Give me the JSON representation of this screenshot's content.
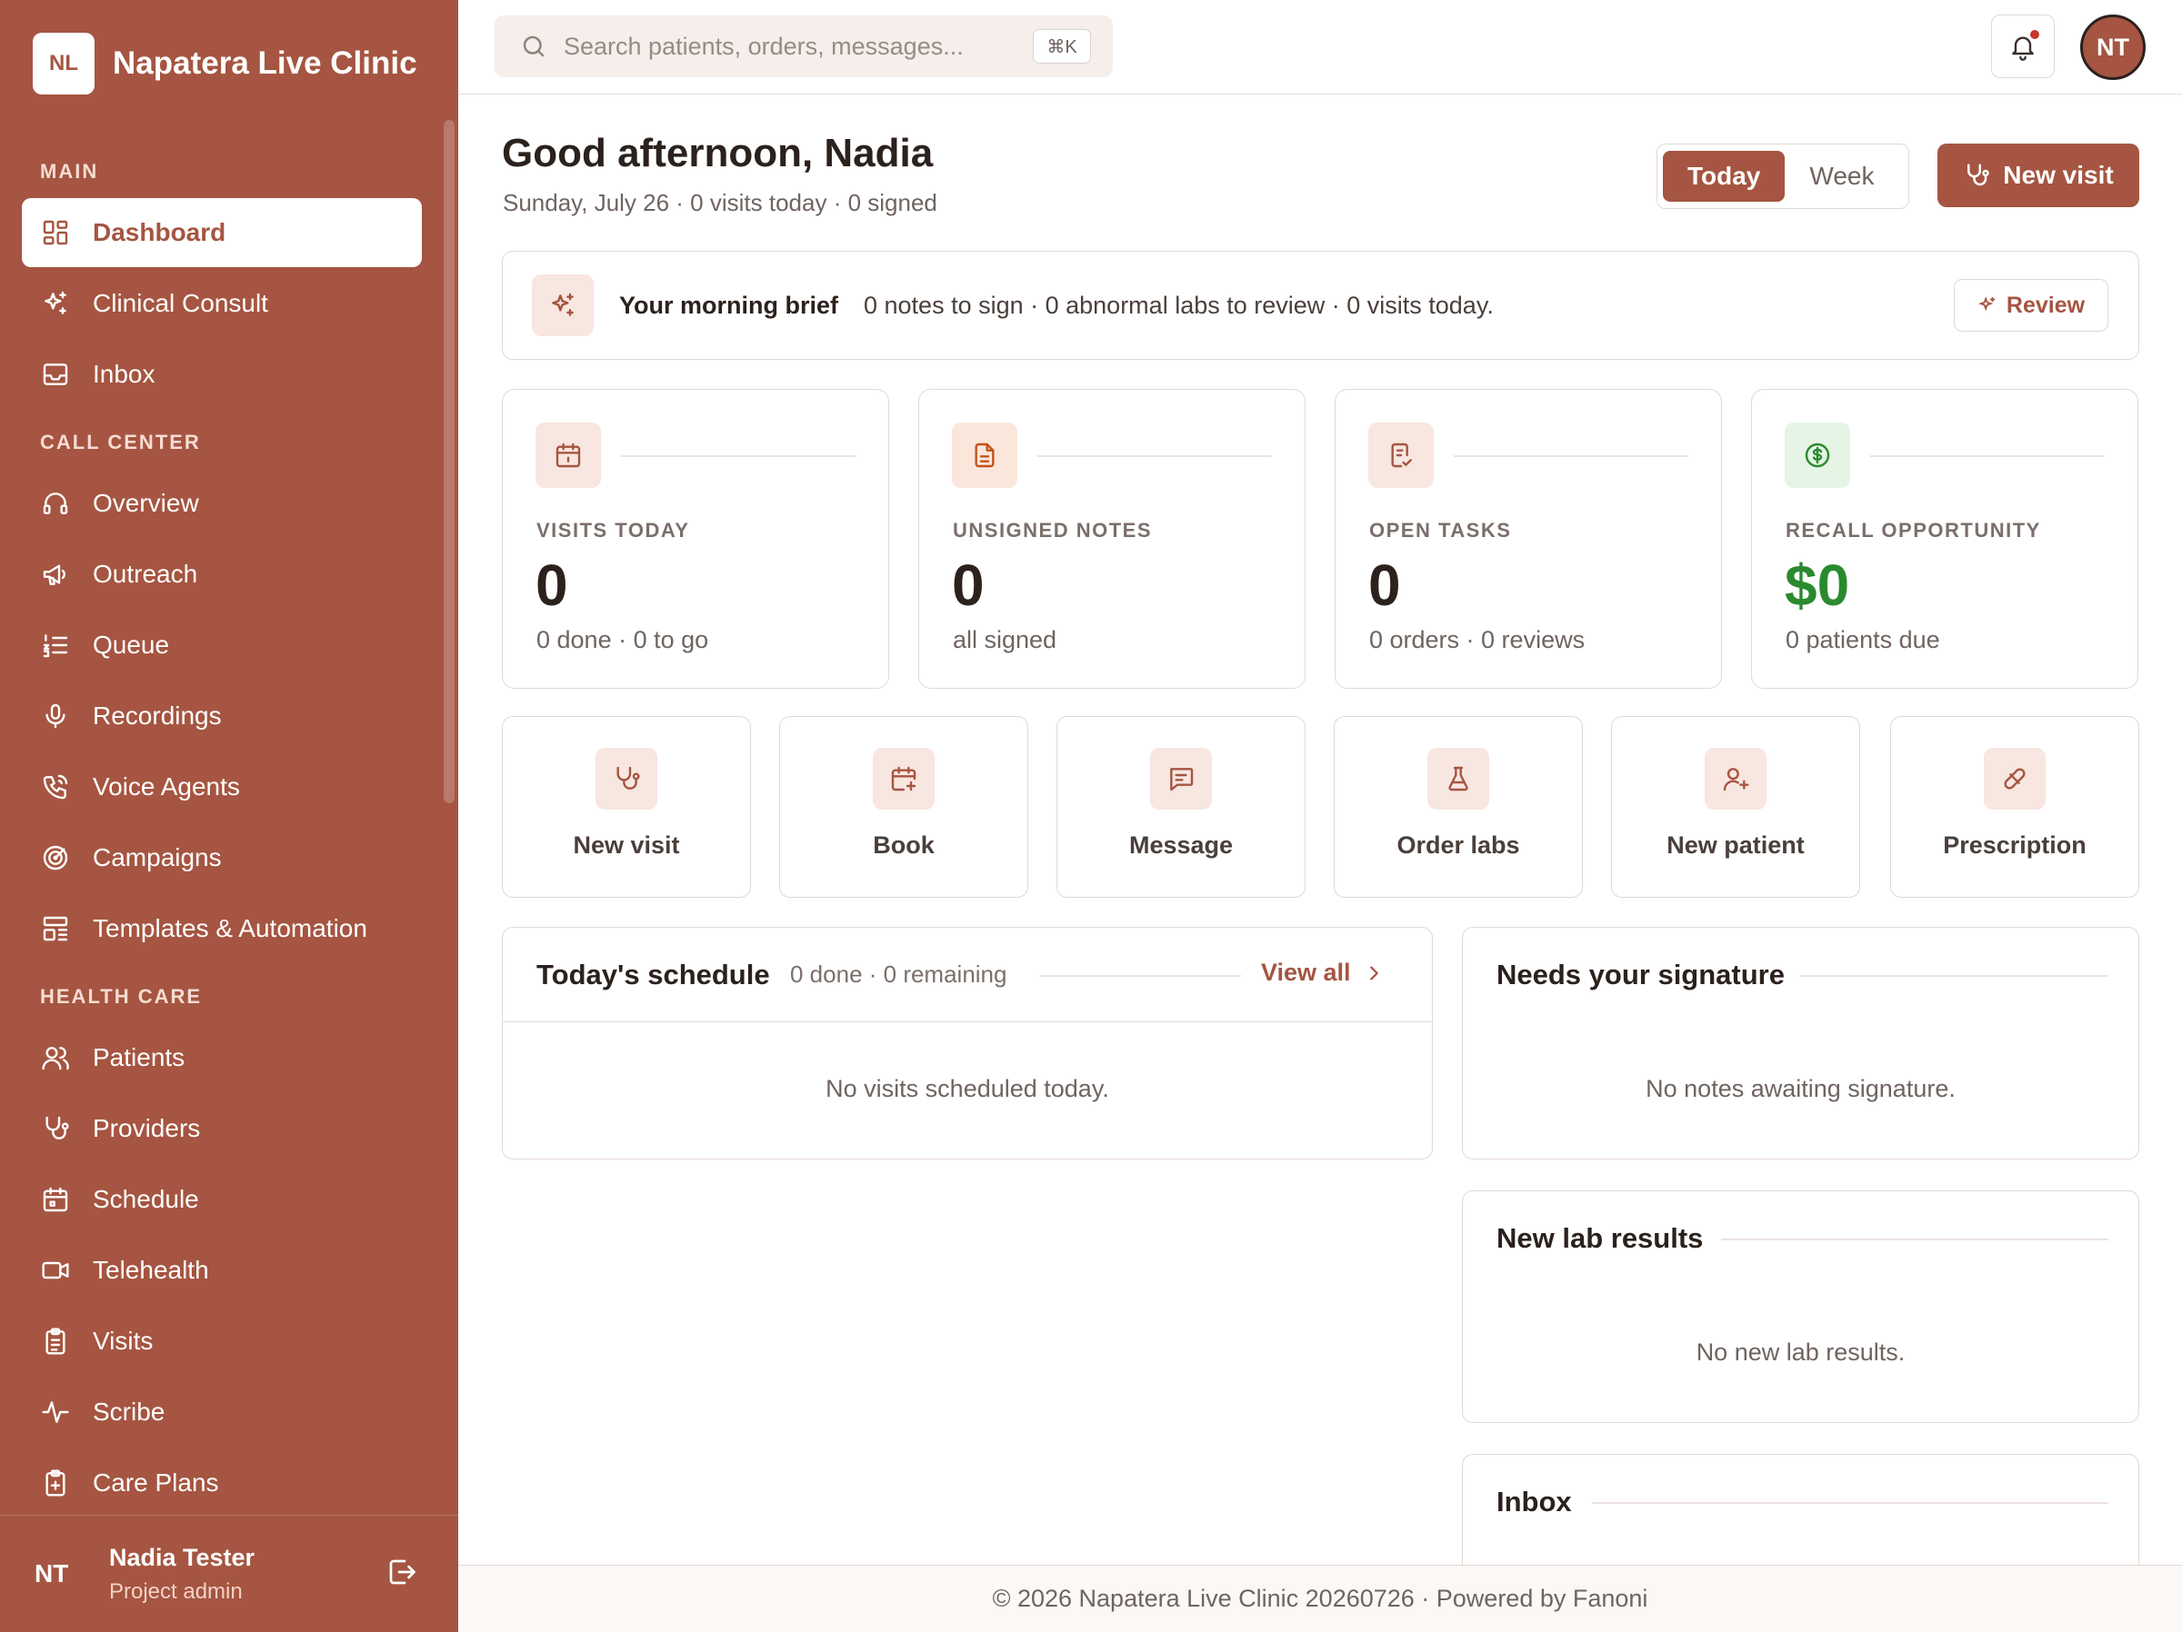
{
  "app": {
    "logo_initials": "NL",
    "name": "Napatera Live Clinic",
    "accent_color": "#a55541",
    "success_color": "#2b8a2e"
  },
  "sidebar": {
    "sections": [
      {
        "title": "MAIN",
        "items": [
          {
            "label": "Dashboard",
            "icon": "dashboard-icon",
            "active": true
          },
          {
            "label": "Clinical Consult",
            "icon": "sparkles-icon"
          },
          {
            "label": "Inbox",
            "icon": "inbox-icon"
          }
        ]
      },
      {
        "title": "CALL CENTER",
        "items": [
          {
            "label": "Overview",
            "icon": "headset-icon"
          },
          {
            "label": "Outreach",
            "icon": "megaphone-icon"
          },
          {
            "label": "Queue",
            "icon": "list-ordered-icon"
          },
          {
            "label": "Recordings",
            "icon": "microphone-icon"
          },
          {
            "label": "Voice Agents",
            "icon": "phone-call-icon"
          },
          {
            "label": "Campaigns",
            "icon": "target-icon"
          },
          {
            "label": "Templates & Automation",
            "icon": "template-icon"
          }
        ]
      },
      {
        "title": "HEALTH CARE",
        "items": [
          {
            "label": "Patients",
            "icon": "users-icon"
          },
          {
            "label": "Providers",
            "icon": "stethoscope-icon"
          },
          {
            "label": "Schedule",
            "icon": "calendar-icon"
          },
          {
            "label": "Telehealth",
            "icon": "video-icon"
          },
          {
            "label": "Visits",
            "icon": "clipboard-list-icon"
          },
          {
            "label": "Scribe",
            "icon": "waveform-icon"
          },
          {
            "label": "Care Plans",
            "icon": "clipboard-plus-icon"
          }
        ]
      }
    ],
    "user": {
      "initials": "NT",
      "name": "Nadia Tester",
      "role": "Project admin"
    }
  },
  "topbar": {
    "search_placeholder": "Search patients, orders, messages...",
    "shortcut": "⌘K",
    "avatar_initials": "NT"
  },
  "header": {
    "greeting": "Good afternoon, Nadia",
    "subline": "Sunday, July 26 · 0 visits today · 0 signed",
    "range_options": [
      "Today",
      "Week"
    ],
    "selected_range": "Today",
    "new_visit_label": "New visit"
  },
  "brief": {
    "title": "Your morning brief",
    "text": "0 notes to sign · 0 abnormal labs to review · 0 visits today.",
    "review_label": "Review"
  },
  "kpis": [
    {
      "label": "VISITS TODAY",
      "value": "0",
      "sub": "0 done · 0 to go",
      "icon": "calendar-icon",
      "color": "#a55541",
      "bg": "#f8e6e0"
    },
    {
      "label": "UNSIGNED NOTES",
      "value": "0",
      "sub": "all signed",
      "icon": "document-icon",
      "color": "#c2521b",
      "bg": "#fbe6db"
    },
    {
      "label": "OPEN TASKS",
      "value": "0",
      "sub": "0 orders · 0 reviews",
      "icon": "task-check-icon",
      "color": "#a55541",
      "bg": "#f8e6e0"
    },
    {
      "label": "RECALL OPPORTUNITY",
      "value": "$0",
      "sub": "0 patients due",
      "icon": "dollar-icon",
      "color": "#2b8a2e",
      "bg": "#e5f4e4"
    }
  ],
  "quick_actions": [
    {
      "label": "New visit",
      "icon": "stethoscope-icon"
    },
    {
      "label": "Book",
      "icon": "calendar-plus-icon"
    },
    {
      "label": "Message",
      "icon": "message-icon"
    },
    {
      "label": "Order labs",
      "icon": "flask-icon"
    },
    {
      "label": "New patient",
      "icon": "user-plus-icon"
    },
    {
      "label": "Prescription",
      "icon": "pill-icon"
    }
  ],
  "schedule": {
    "title": "Today's schedule",
    "meta": "0 done · 0 remaining",
    "view_all": "View all",
    "empty": "No visits scheduled today."
  },
  "signature": {
    "title": "Needs your signature",
    "empty": "No notes awaiting signature."
  },
  "labs": {
    "title": "New lab results",
    "empty": "No new lab results."
  },
  "inbox": {
    "title": "Inbox"
  },
  "footer": {
    "text": "© 2026 Napatera Live Clinic 20260726 · Powered by Fanoni"
  }
}
